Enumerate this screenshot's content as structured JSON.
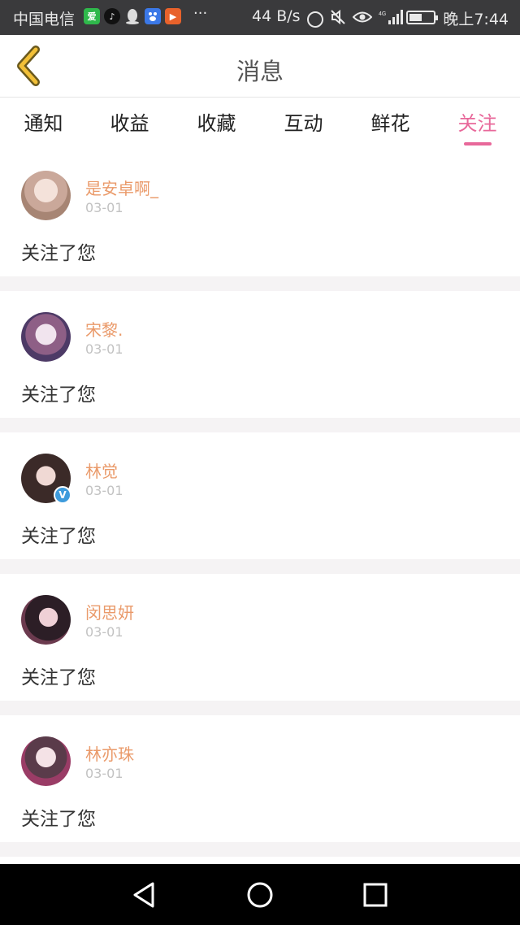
{
  "status_bar": {
    "carrier": "中国电信",
    "more": "···",
    "speed": "44 B/s",
    "time": "晚上7:44",
    "battery_level": 0.55,
    "app_icons": [
      "iqiyi-icon",
      "tiktok-icon",
      "qq-icon",
      "baidu-icon",
      "video-icon"
    ]
  },
  "header": {
    "title": "消息"
  },
  "tabs": [
    {
      "label": "通知"
    },
    {
      "label": "收益"
    },
    {
      "label": "收藏"
    },
    {
      "label": "互动"
    },
    {
      "label": "鲜花"
    },
    {
      "label": "关注"
    }
  ],
  "active_tab": "关注",
  "notifications": [
    {
      "name": "是安卓啊_",
      "date": "03-01",
      "message": "关注了您",
      "verified": false
    },
    {
      "name": "宋黎.",
      "date": "03-01",
      "message": "关注了您",
      "verified": false
    },
    {
      "name": "林觉",
      "date": "03-01",
      "message": "关注了您",
      "verified": true
    },
    {
      "name": "闵思妍",
      "date": "03-01",
      "message": "关注了您",
      "verified": false
    },
    {
      "name": "林亦珠",
      "date": "03-01",
      "message": "关注了您",
      "verified": false
    }
  ],
  "verified_mark": "V",
  "colors": {
    "accent": "#e8689a",
    "username": "#ea9a6a",
    "back_arrow": "#f2c038"
  }
}
